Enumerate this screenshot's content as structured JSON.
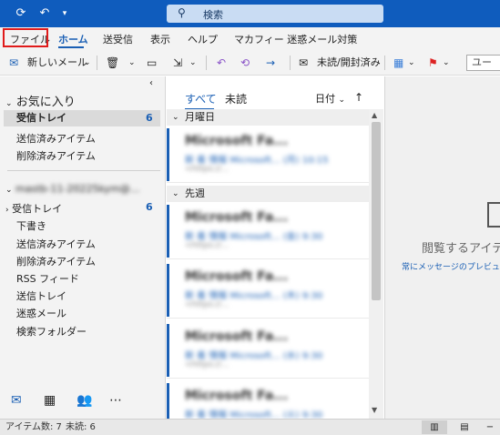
{
  "titlebar": {
    "search_placeholder": "検索"
  },
  "menu": {
    "tabs": [
      "ファイル",
      "ホーム",
      "送受信",
      "表示",
      "ヘルプ",
      "マカフィー 迷惑メール対策"
    ]
  },
  "ribbon": {
    "new_mail": "新しいメール",
    "unread_read": "未読/開封済み",
    "search_placeholder": "ユー"
  },
  "favorites": {
    "header": "お気に入り",
    "items": [
      {
        "label": "受信トレイ",
        "count": "6"
      },
      {
        "label": "送信済みアイテム",
        "count": ""
      },
      {
        "label": "削除済みアイテム",
        "count": ""
      }
    ]
  },
  "account": {
    "name": "mastb-11-20225kym@…",
    "items": [
      {
        "label": "受信トレイ",
        "count": "6"
      },
      {
        "label": "下書き",
        "count": ""
      },
      {
        "label": "送信済みアイテム",
        "count": ""
      },
      {
        "label": "削除済みアイテム",
        "count": ""
      },
      {
        "label": "RSS フィード",
        "count": ""
      },
      {
        "label": "送信トレイ",
        "count": ""
      },
      {
        "label": "迷惑メール",
        "count": ""
      },
      {
        "label": "検索フォルダー",
        "count": ""
      }
    ]
  },
  "message_list": {
    "tab_all": "すべて",
    "tab_unread": "未読",
    "sort_label": "日付",
    "sections": [
      {
        "label": "月曜日",
        "messages": [
          {
            "sender": "Microsoft Fa...",
            "line1": "新 着 情報 Microsoft...   (月) 10:15",
            "line2": "<https://..."
          }
        ]
      },
      {
        "label": "先週",
        "messages": [
          {
            "sender": "Microsoft Fa...",
            "line1": "新 着 情報 Microsoft...   (金) 9:30",
            "line2": "<https://..."
          },
          {
            "sender": "Microsoft Fa...",
            "line1": "新 着 情報 Microsoft...   (木) 9:30",
            "line2": "<https://..."
          },
          {
            "sender": "Microsoft Fa...",
            "line1": "新 着 情報 Microsoft...   (水) 9:30",
            "line2": "<https://..."
          },
          {
            "sender": "Microsoft Fa...",
            "line1": "新 着 情報 Microsoft...   (火) 9:30",
            "line2": "<https://..."
          }
        ]
      }
    ]
  },
  "reading_pane": {
    "title": "閲覧するアイテ",
    "link": "常にメッセージのプレビューを表"
  },
  "status": {
    "items_count": "アイテム数: 7",
    "unread_count": "未読: 6"
  },
  "colors": {
    "title_bar": "#0f5cbd",
    "accent": "#1a5fb4",
    "highlight_box": "#e01b1b"
  }
}
